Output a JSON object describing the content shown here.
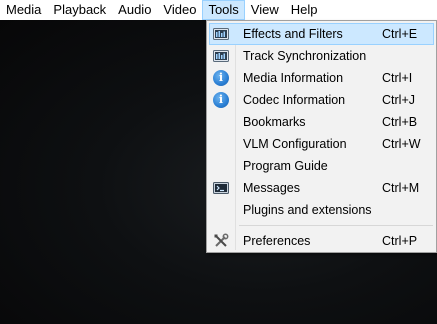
{
  "menubar": {
    "items": [
      "Media",
      "Playback",
      "Audio",
      "Video",
      "Tools",
      "View",
      "Help"
    ]
  },
  "tools_menu": {
    "items": [
      {
        "label": "Effects and Filters",
        "shortcut": "Ctrl+E",
        "icon": "equalizer-icon"
      },
      {
        "label": "Track Synchronization",
        "shortcut": "",
        "icon": "equalizer-icon"
      },
      {
        "label": "Media Information",
        "shortcut": "Ctrl+I",
        "icon": "info-icon"
      },
      {
        "label": "Codec Information",
        "shortcut": "Ctrl+J",
        "icon": "info-icon"
      },
      {
        "label": "Bookmarks",
        "shortcut": "Ctrl+B",
        "icon": ""
      },
      {
        "label": "VLM Configuration",
        "shortcut": "Ctrl+W",
        "icon": ""
      },
      {
        "label": "Program Guide",
        "shortcut": "",
        "icon": ""
      },
      {
        "label": "Messages",
        "shortcut": "Ctrl+M",
        "icon": "terminal-icon"
      },
      {
        "label": "Plugins and extensions",
        "shortcut": "",
        "icon": ""
      },
      {
        "label": "Preferences",
        "shortcut": "Ctrl+P",
        "icon": "tools-icon"
      }
    ],
    "highlighted_index": 0
  },
  "colors": {
    "highlight": "#cce8ff",
    "highlight_border": "#99d1ff",
    "menu_bg": "#f2f2f2",
    "info_blue": "#2a7fd4"
  }
}
